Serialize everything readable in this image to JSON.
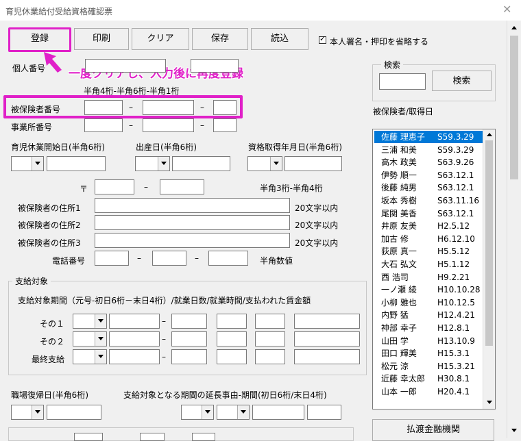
{
  "window": {
    "title": "育児休業給付受給資格確認票",
    "close": "✕"
  },
  "toolbar": {
    "register": "登録",
    "print": "印刷",
    "clear": "クリア",
    "save": "保存",
    "load": "読込",
    "omit_check": "本人署名・押印を省略する"
  },
  "callout": "一度クリアし、入力後に再度登録",
  "personal_no": {
    "label": "個人番号"
  },
  "insured": {
    "hint": "半角4桁-半角6桁-半角1桁",
    "insured_no": "被保険者番号",
    "office_no": "事業所番号",
    "dash": "–"
  },
  "dates": {
    "leave_start": "育児休業開始日(半角6桁)",
    "birth": "出産日(半角6桁)",
    "qualified": "資格取得年月日(半角6桁)"
  },
  "address": {
    "postal_mark": "〒",
    "postal_hint": "半角3桁-半角4桁",
    "addr1": "被保険者の住所1",
    "addr2": "被保険者の住所2",
    "addr3": "被保険者の住所3",
    "limit": "20文字以内",
    "phone": "電話番号",
    "phone_hint": "半角数値"
  },
  "payment": {
    "group": "支給対象",
    "desc": "支給対象期間（元号-初日6桁－末日4桁）/就業日数/就業時間/支払われた賃金額",
    "row1": "その１",
    "row2": "その２",
    "row3": "最終支給"
  },
  "return": {
    "label": "職場復帰日(半角6桁)",
    "extension": "支給対象となる期間の延長事由-期間(初日6桁/末日4桁)"
  },
  "search": {
    "group": "検索",
    "button": "検索",
    "list_label": "被保険者/取得日"
  },
  "list": [
    {
      "name": "佐藤 理恵子",
      "date": "S59.3.29"
    },
    {
      "name": "三浦 和美",
      "date": "S59.3.29"
    },
    {
      "name": "高木 政美",
      "date": "S63.9.26"
    },
    {
      "name": "伊勢 順一",
      "date": "S63.12.1"
    },
    {
      "name": "後藤 純男",
      "date": "S63.12.1"
    },
    {
      "name": "坂本 秀樹",
      "date": "S63.11.16"
    },
    {
      "name": "尾関 美香",
      "date": "S63.12.1"
    },
    {
      "name": "井原 友美",
      "date": "H2.5.12"
    },
    {
      "name": "加古 修",
      "date": "H6.12.10"
    },
    {
      "name": "荻原 真一",
      "date": "H5.5.12"
    },
    {
      "name": "大石 弘文",
      "date": "H5.1.12"
    },
    {
      "name": "西 浩司",
      "date": "H9.2.21"
    },
    {
      "name": "一ノ瀬 綾",
      "date": "H10.10.28"
    },
    {
      "name": "小柳 雅也",
      "date": "H10.12.5"
    },
    {
      "name": "内野 猛",
      "date": "H12.4.21"
    },
    {
      "name": "神部 幸子",
      "date": "H12.8.1"
    },
    {
      "name": "山田 学",
      "date": "H13.10.9"
    },
    {
      "name": "田口 輝美",
      "date": "H15.3.1"
    },
    {
      "name": "松元 涼",
      "date": "H15.3.21"
    },
    {
      "name": "近藤 幸太郎",
      "date": "H30.8.1"
    },
    {
      "name": "山本 一郎",
      "date": "H20.4.1"
    }
  ],
  "bank_button": "払渡金融機関",
  "colors": {
    "highlight": "#e020c8",
    "selection": "#0078d7"
  }
}
